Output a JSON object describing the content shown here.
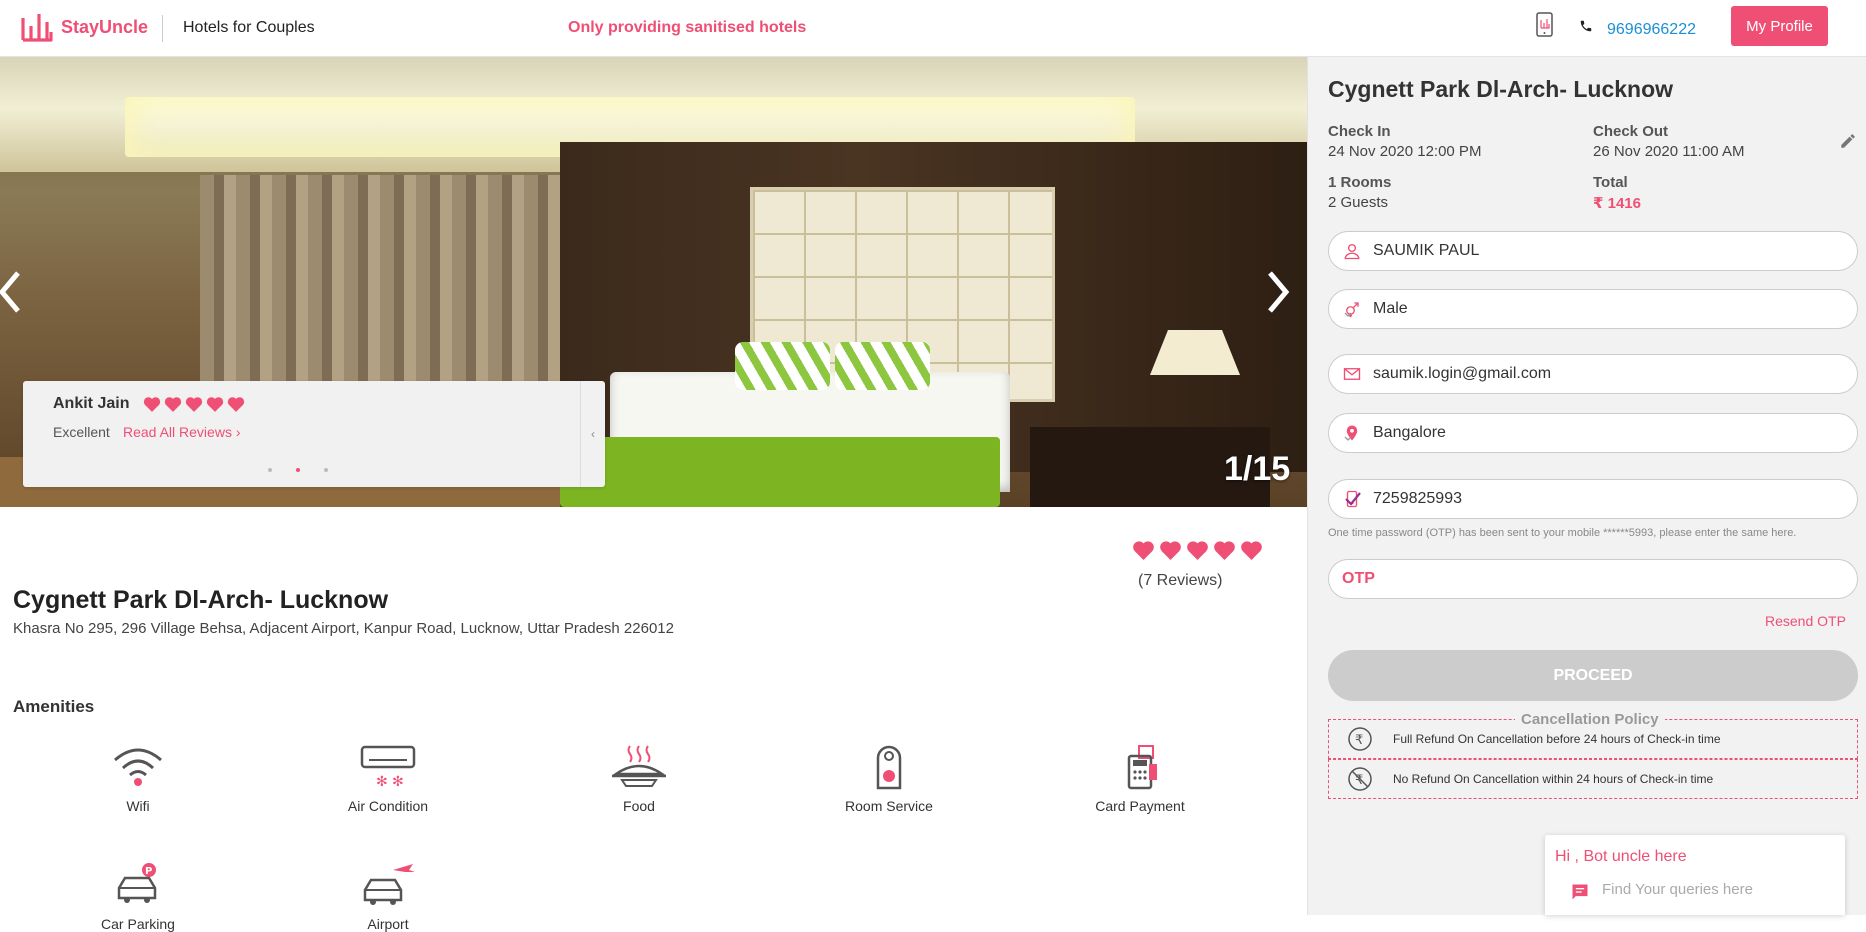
{
  "header": {
    "brand": "StayUncle",
    "tagline": "Hotels for Couples",
    "notice": "Only providing sanitised hotels",
    "phone": "9696966222",
    "profile_button": "My Profile",
    "brand_color": "#ef4f74",
    "icons": [
      "stayuncle-logo-icon",
      "mobile-app-icon",
      "phone-icon"
    ]
  },
  "gallery": {
    "counter": "1/15",
    "icons": [
      "chevron-left-icon",
      "chevron-right-icon"
    ]
  },
  "review": {
    "name": "Ankit Jain",
    "hearts": 5,
    "rating_text": "Excellent",
    "link": "Read All Reviews ›",
    "collapse": "‹",
    "dots_total": 3,
    "dots_active": 2
  },
  "hotel": {
    "name": "Cygnett Park Dl-Arch- Lucknow",
    "address": "Khasra No 295, 296 Village Behsa, Adjacent Airport, Kanpur Road, Lucknow, Uttar Pradesh 226012",
    "hearts": 5,
    "reviews": "(7 Reviews)"
  },
  "amenities": {
    "title": "Amenities",
    "items": [
      {
        "label": "Wifi",
        "icon": "wifi-icon"
      },
      {
        "label": "Air Condition",
        "icon": "air-condition-icon"
      },
      {
        "label": "Food",
        "icon": "food-icon"
      },
      {
        "label": "Room Service",
        "icon": "room-service-icon"
      },
      {
        "label": "Card Payment",
        "icon": "card-payment-icon"
      },
      {
        "label": "Car Parking",
        "icon": "car-parking-icon"
      },
      {
        "label": "Airport",
        "icon": "airport-taxi-icon"
      }
    ]
  },
  "booking": {
    "title": "Cygnett Park Dl-Arch- Lucknow",
    "check_in_label": "Check In",
    "check_in": "24 Nov 2020 12:00 PM",
    "check_out_label": "Check Out",
    "check_out": "26 Nov 2020 11:00 AM",
    "rooms": "1 Rooms",
    "guests": "2 Guests",
    "total_label": "Total",
    "total": "₹ 1416",
    "name": "SAUMIK PAUL",
    "gender": "Male",
    "email": "saumik.login@gmail.com",
    "city": "Bangalore",
    "mobile": "7259825993",
    "otp_note": "One time password (OTP) has been sent to your mobile ******5993, please enter the same here.",
    "otp_placeholder": "OTP",
    "resend": "Resend OTP",
    "proceed": "PROCEED",
    "policy_title": "Cancellation Policy",
    "policy_full": "Full Refund On Cancellation before 24 hours of Check-in time",
    "policy_none": "No Refund On Cancellation within 24 hours of Check-in time"
  },
  "chatbot": {
    "title": "Hi , Bot uncle here",
    "placeholder": "Find Your queries here"
  }
}
